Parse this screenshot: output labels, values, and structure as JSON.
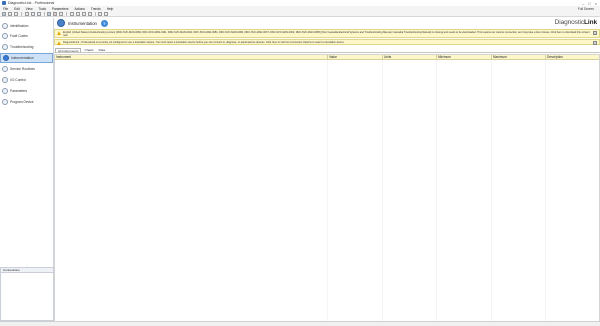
{
  "window": {
    "title": "DiagnosticLink - Professional",
    "controls": [
      "–",
      "□",
      "×"
    ]
  },
  "menu": {
    "items": [
      "File",
      "Edit",
      "View",
      "Tools",
      "Parameters",
      "Actions",
      "Trends",
      "Help"
    ],
    "right_label": "Full Screen"
  },
  "toolbar": {
    "buttons": [
      {
        "icon": "home-icon",
        "style": "blue"
      },
      {
        "icon": "back-icon",
        "style": ""
      },
      {
        "icon": "forward-icon",
        "style": ""
      },
      {
        "icon": "open-icon",
        "style": ""
      },
      {
        "icon": "save-icon",
        "style": ""
      },
      {
        "icon": "print-icon",
        "style": ""
      },
      {
        "icon": "connect-icon",
        "style": "blue"
      },
      {
        "icon": "disconnect-icon",
        "style": "red"
      },
      {
        "icon": "refresh-icon",
        "style": ""
      },
      {
        "icon": "copy-icon",
        "style": ""
      },
      {
        "icon": "paste-icon",
        "style": ""
      },
      {
        "icon": "undo-icon",
        "style": ""
      },
      {
        "icon": "redo-icon",
        "style": ""
      },
      {
        "icon": "tools-icon",
        "style": ""
      },
      {
        "icon": "help-icon",
        "style": ""
      }
    ]
  },
  "sidebar": {
    "items": [
      {
        "label": "Identification",
        "icon": "identification-icon",
        "selected": false
      },
      {
        "label": "Fault Codes",
        "icon": "fault-codes-icon",
        "selected": false
      },
      {
        "label": "Troubleshooting",
        "icon": "troubleshooting-icon",
        "selected": false
      },
      {
        "label": "Instrumentation",
        "icon": "instrumentation-icon",
        "selected": true
      },
      {
        "label": "Service Routines",
        "icon": "service-routines-icon",
        "selected": false
      },
      {
        "label": "I/O Control",
        "icon": "io-control-icon",
        "selected": false
      },
      {
        "label": "Parameters",
        "icon": "parameters-icon",
        "selected": false
      },
      {
        "label": "Program Device",
        "icon": "program-device-icon",
        "selected": false
      }
    ],
    "splitter": "...",
    "connections_title": "Connections"
  },
  "main": {
    "title": "Instrumentation",
    "brand_prefix": "Diagnostic",
    "brand_suffix": "Link",
    "warnings": [
      "English (United States) troubleshooting content (DDC-SVC-MAN-0084, DDC-SVC-MAN-0191, DDC-SVC-MAN-0192, DDC-SVC-MAN-0081, DDC-SVC-MAN-0082, DDC-SVC-MAN-0073, DDC-SVC-MAN-0002, DDC-SVC-MAN-0085) (Non Cascadia Electrical Systems and Troubleshooting Manual, Cascadia Troubleshooting Manual) is missing and needs to be downloaded. This requires an internet connection, and may take a few minutes. Click here to download this content now.",
      "DiagnosticLink - Professional is currently not configured to use a translation device. You must select a translation device before you can connect to, diagnose, or parameterize devices. Click here to visit the Connection Options to select a translation device."
    ],
    "tabs": [
      "All Instruments",
      "Charts",
      "Data"
    ],
    "columns": [
      "Instrument",
      "Value",
      "Units",
      "Minimum",
      "Maximum",
      "Description"
    ]
  }
}
